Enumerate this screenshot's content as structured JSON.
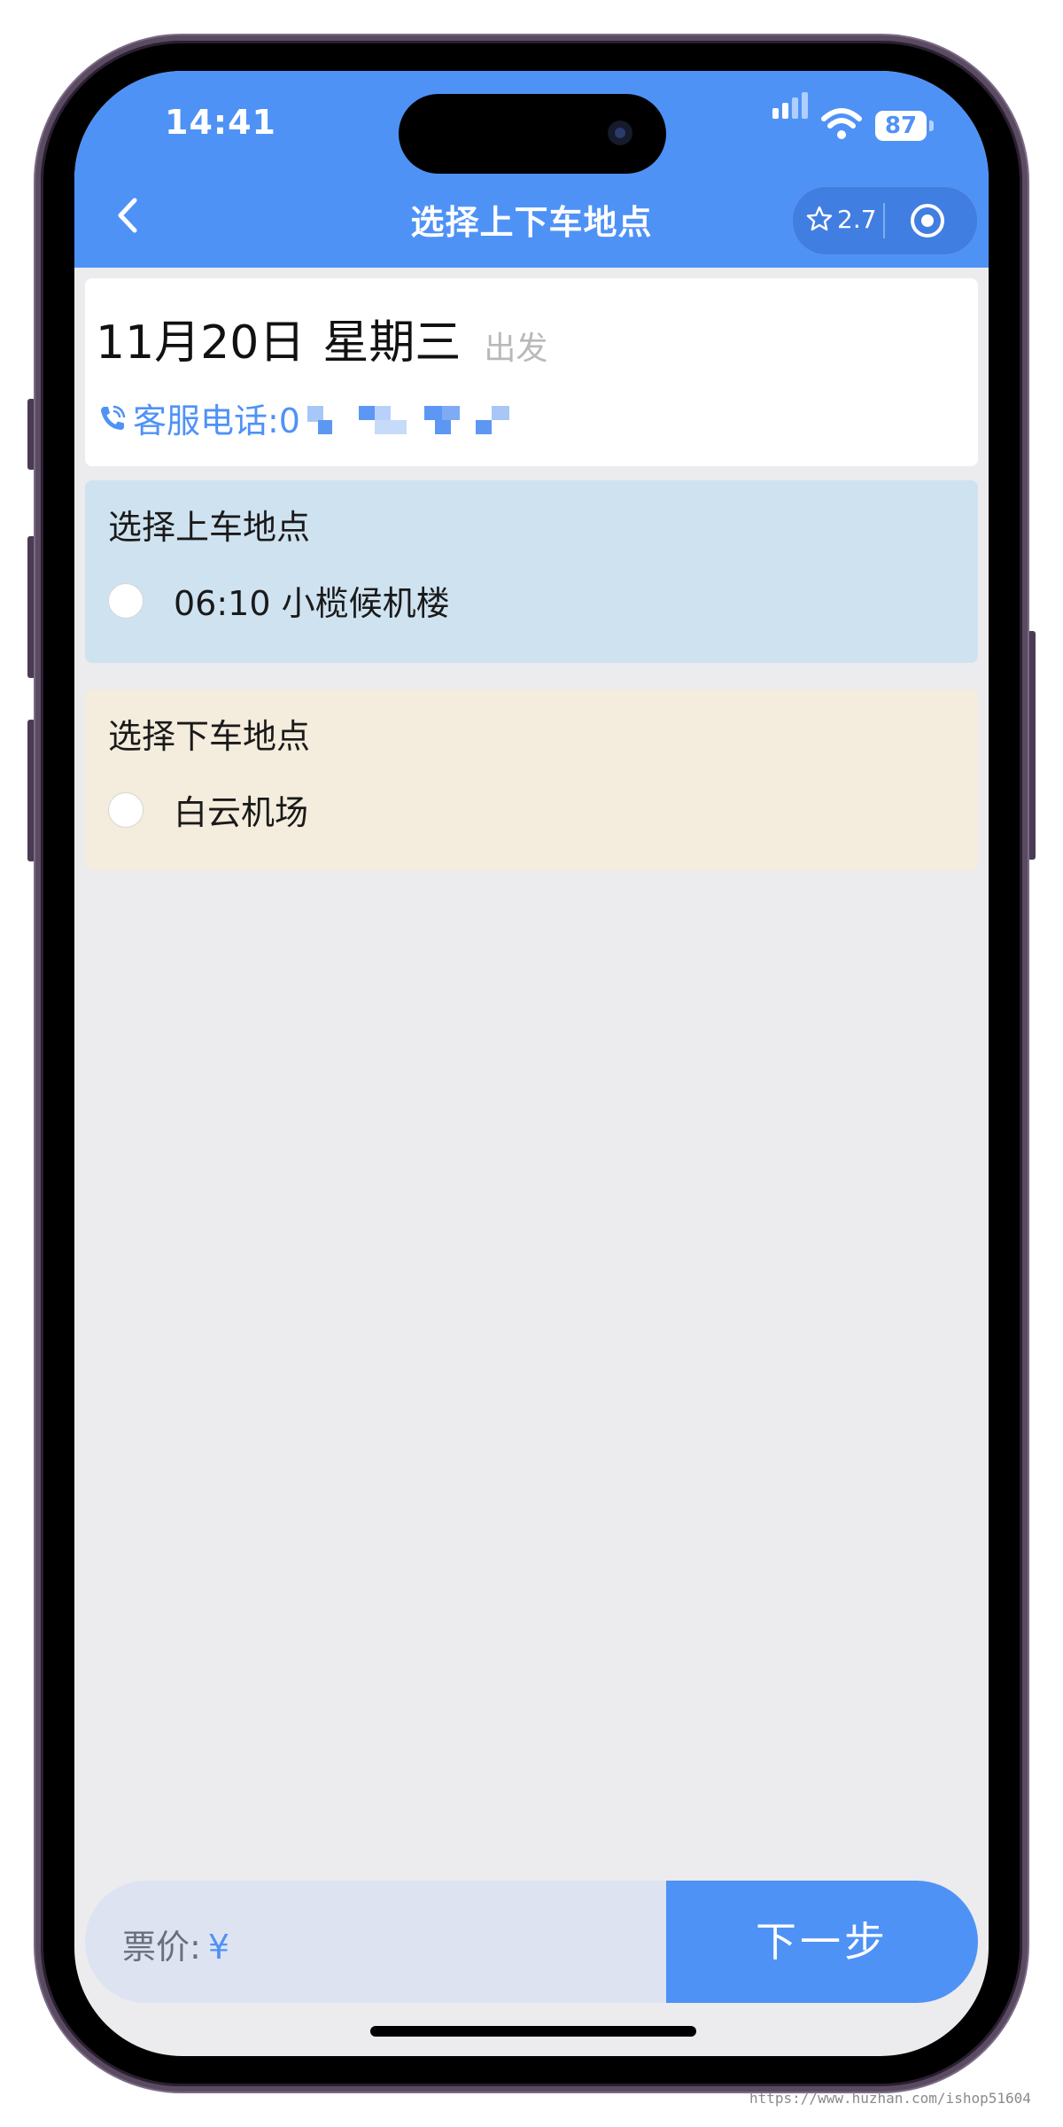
{
  "status_bar": {
    "time": "14:41",
    "battery": "87"
  },
  "header": {
    "title": "选择上下车地点",
    "rating": "2.7",
    "icons": [
      "back-icon",
      "star-icon",
      "target-icon"
    ]
  },
  "trip": {
    "date": "11月20日",
    "weekday": "星期三",
    "depart_label": "出发",
    "service_phone_label": "客服电话:0"
  },
  "boarding": {
    "title": "选择上车地点",
    "options": [
      {
        "label": "06:10 小榄候机楼",
        "selected": false
      }
    ]
  },
  "dropoff": {
    "title": "选择下车地点",
    "options": [
      {
        "label": "白云机场",
        "selected": false
      }
    ]
  },
  "footer": {
    "price_label": "票价:",
    "price_currency": "¥",
    "next_label": "下一步"
  },
  "watermark": "https://www.huzhan.com/ishop51604",
  "colors": {
    "primary": "#4f92f6",
    "board_bg": "#cfe2f0",
    "drop_bg": "#f4ecdc",
    "page_bg": "#ecebee"
  }
}
